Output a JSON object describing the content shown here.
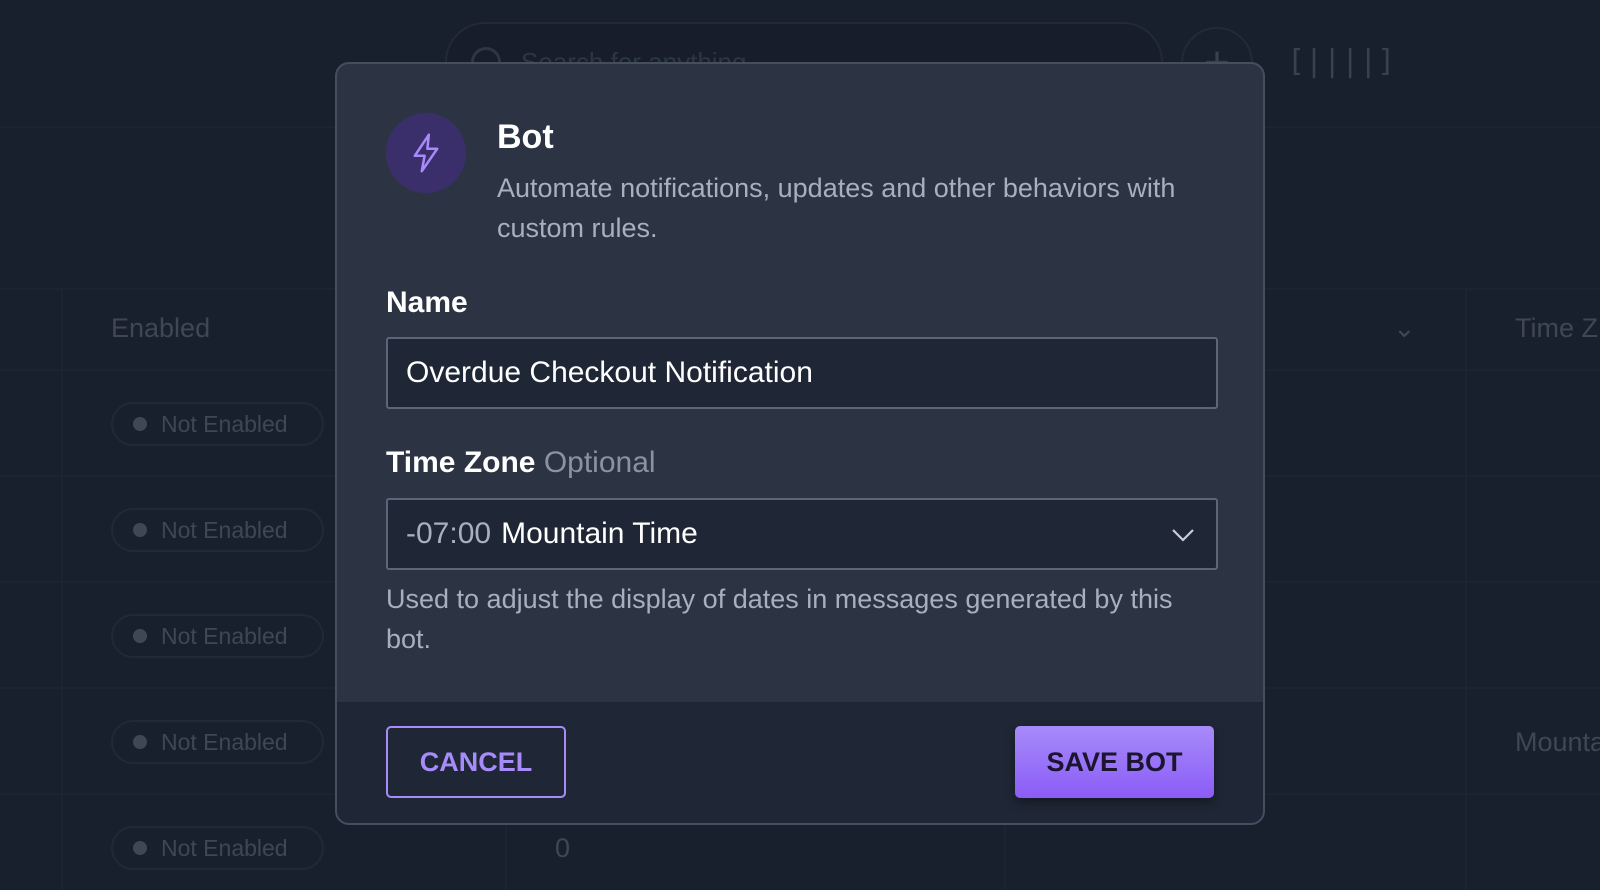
{
  "background": {
    "search_placeholder": "Search for anything",
    "columns": [
      "Enabled",
      "Time Z"
    ],
    "rows": [
      {
        "status": "Not Enabled",
        "time_zone": ""
      },
      {
        "status": "Not Enabled",
        "time_zone": ""
      },
      {
        "status": "Not Enabled",
        "time_zone": ""
      },
      {
        "status": "Not Enabled",
        "time_zone": "Mounta"
      },
      {
        "status": "Not Enabled",
        "time_zone": "",
        "count": "0"
      }
    ]
  },
  "modal": {
    "icon": "lightning-bolt-icon",
    "title": "Bot",
    "description": "Automate notifications, updates and other behaviors with custom rules.",
    "name_label": "Name",
    "name_value": "Overdue Checkout Notification",
    "tz_label": "Time Zone",
    "tz_optional": "Optional",
    "tz_offset": "-07:00",
    "tz_name": "Mountain Time",
    "tz_help": "Used to adjust the display of dates in messages generated by this bot.",
    "cancel_label": "CANCEL",
    "save_label": "SAVE BOT"
  },
  "colors": {
    "accent": "#a78bfa",
    "accent_dark": "#8b5cf6",
    "background": "#1e2636",
    "modal": "#2c3444"
  }
}
